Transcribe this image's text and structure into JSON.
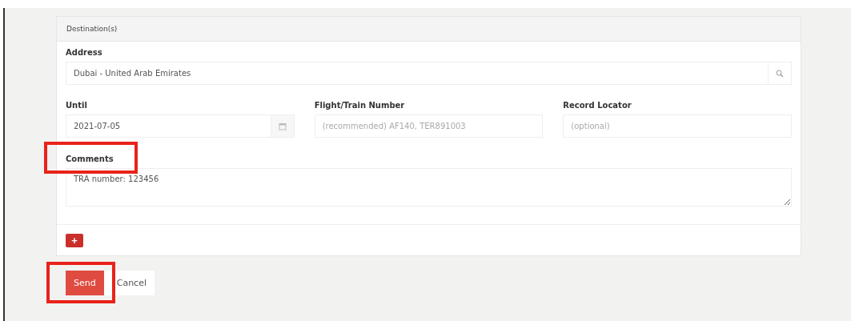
{
  "panel": {
    "title": "Destination(s)"
  },
  "address": {
    "label": "Address",
    "value": "Dubai - United Arab Emirates"
  },
  "until": {
    "label": "Until",
    "value": "2021-07-05"
  },
  "flight": {
    "label": "Flight/Train Number",
    "placeholder": "(recommended) AF140, TER891003"
  },
  "record": {
    "label": "Record Locator",
    "placeholder": "(optional)"
  },
  "comments": {
    "label": "Comments",
    "value": "TRA number: 123456"
  },
  "add_button": {
    "label": "+"
  },
  "buttons": [
    {
      "label": "Send",
      "kind": "primary"
    },
    {
      "label": "Cancel",
      "kind": "secondary"
    }
  ]
}
